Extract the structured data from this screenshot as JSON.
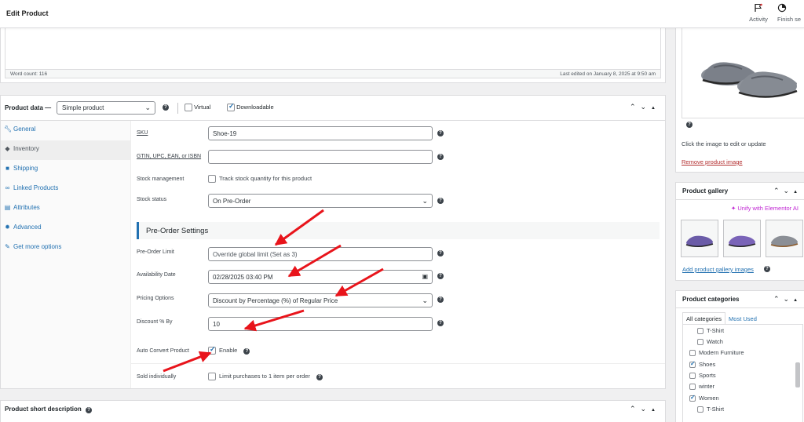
{
  "topbar": {
    "title": "Edit Product",
    "activity_label": "Activity",
    "finish_label": "Finish se"
  },
  "editor": {
    "word_count": "Word count: 116",
    "last_edited": "Last edited on January 8, 2025 at 9:50 am"
  },
  "product_data": {
    "label": "Product data —",
    "type_value": "Simple product",
    "virtual_label": "Virtual",
    "virtual_checked": false,
    "downloadable_label": "Downloadable",
    "downloadable_checked": true
  },
  "tabs": [
    {
      "label": "General",
      "icon": "wrench-icon"
    },
    {
      "label": "Inventory",
      "icon": "tag-icon"
    },
    {
      "label": "Shipping",
      "icon": "truck-icon"
    },
    {
      "label": "Linked Products",
      "icon": "link-icon"
    },
    {
      "label": "Attributes",
      "icon": "list-icon"
    },
    {
      "label": "Advanced",
      "icon": "gear-icon"
    },
    {
      "label": "Get more options",
      "icon": "plug-icon"
    }
  ],
  "inventory": {
    "sku_label": "SKU",
    "sku_value": "Shoe-19",
    "gtin_label": "GTIN, UPC, EAN, or ISBN",
    "gtin_value": "",
    "stock_mgmt_label": "Stock management",
    "stock_mgmt_text": "Track stock quantity for this product",
    "stock_status_label": "Stock status",
    "stock_status_value": "On Pre-Order"
  },
  "preorder": {
    "heading": "Pre-Order Settings",
    "limit_label": "Pre-Order Limit",
    "limit_placeholder": "Override global limit (Set as 3)",
    "availability_label": "Availability Date",
    "availability_value": "02/28/2025 03:40 PM",
    "pricing_label": "Pricing Options",
    "pricing_value": "Discount by Percentage (%) of Regular Price",
    "discount_label": "Discount % By",
    "discount_value": "10",
    "auto_convert_label": "Auto Convert Product",
    "auto_convert_text": "Enable",
    "auto_convert_checked": true,
    "sold_individually_label": "Sold individually",
    "sold_individually_text": "Limit purchases to 1 item per order"
  },
  "short_description": {
    "label": "Product short description"
  },
  "product_image": {
    "hint": "Click the image to edit or update",
    "remove_link": "Remove product image"
  },
  "gallery": {
    "title": "Product gallery",
    "elementor_link": "Unify with Elementor AI",
    "add_link": "Add product gallery images"
  },
  "categories": {
    "title": "Product categories",
    "tab_all": "All categories",
    "tab_most": "Most Used",
    "items": [
      {
        "label": "T-Shirt",
        "checked": false
      },
      {
        "label": "Watch",
        "checked": false
      },
      {
        "label": "Modern Furniture",
        "checked": false
      },
      {
        "label": "Shoes",
        "checked": true
      },
      {
        "label": "Sports",
        "checked": false
      },
      {
        "label": "winter",
        "checked": false
      },
      {
        "label": "Women",
        "checked": true
      },
      {
        "label": "T-Shirt",
        "checked": false
      }
    ]
  },
  "colors": {
    "accent": "#2271b1",
    "danger": "#b32d2e",
    "arrow": "#e8141b"
  }
}
